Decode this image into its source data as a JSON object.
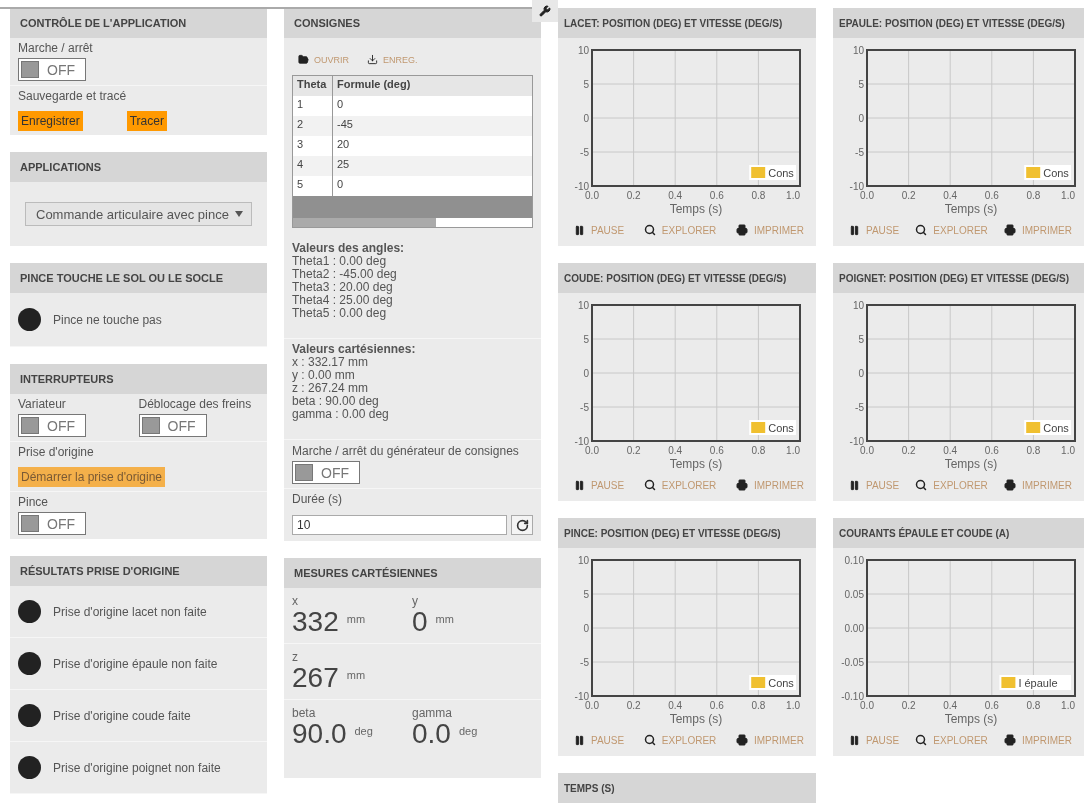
{
  "columns": [
    {
      "panels": [
        {
          "title": "CONTRÔLE DE L'APPLICATION",
          "rows": [
            {
              "kind": "toggle",
              "label": "Marche / arrêt",
              "toggle": {
                "text": "OFF",
                "on": false
              }
            },
            {
              "kind": "buttons",
              "label": "Sauvegarde et tracé",
              "buttons": [
                {
                  "text": "Enregistrer",
                  "disabled": false
                },
                {
                  "text": "Tracer",
                  "disabled": false
                }
              ]
            }
          ]
        },
        {
          "title": "APPLICATIONS",
          "rows": [
            {
              "kind": "select",
              "value": "Commande articulaire avec pince"
            }
          ]
        },
        {
          "title": "PINCE TOUCHE LE SOL OU LE SOCLE",
          "rows": [
            {
              "kind": "indicator",
              "text": "Pince ne touche pas",
              "lit": false
            }
          ]
        },
        {
          "title": "INTERRUPTEURS",
          "rows": [
            {
              "kind": "toggle_pair",
              "toggles": [
                {
                  "label": "Variateur",
                  "text": "OFF",
                  "on": false
                },
                {
                  "label": "Déblocage des freins",
                  "text": "OFF",
                  "on": false
                }
              ]
            },
            {
              "kind": "buttons",
              "label": "Prise d'origine",
              "buttons": [
                {
                  "text": "Démarrer la prise d'origine",
                  "disabled": true
                }
              ]
            },
            {
              "kind": "toggle",
              "label": "Pince",
              "toggle": {
                "text": "OFF",
                "on": false
              }
            }
          ]
        },
        {
          "title": "RÉSULTATS PRISE D'ORIGINE",
          "rows": [
            {
              "kind": "indicator",
              "text": "Prise d'origine lacet non faite",
              "lit": false
            },
            {
              "kind": "indicator",
              "text": "Prise d'origine épaule non faite",
              "lit": false
            },
            {
              "kind": "indicator",
              "text": "Prise d'origine coude faite",
              "lit": false
            },
            {
              "kind": "indicator",
              "text": "Prise d'origine poignet non faite",
              "lit": false
            }
          ]
        }
      ]
    },
    {
      "panels": [
        {
          "title": "CONSIGNES",
          "rows": [
            {
              "kind": "file_actions",
              "actions": [
                {
                  "kind": "open",
                  "label": "OUVRIR"
                },
                {
                  "kind": "save",
                  "label": "ENREG."
                }
              ]
            },
            {
              "kind": "table",
              "columns": [
                "Theta",
                "Formule (deg)"
              ],
              "rows": [
                [
                  "1",
                  "0"
                ],
                [
                  "2",
                  "-45"
                ],
                [
                  "3",
                  "20"
                ],
                [
                  "4",
                  "25"
                ],
                [
                  "5",
                  "0"
                ]
              ]
            },
            {
              "kind": "readout",
              "heading": "Valeurs des angles:",
              "lines": [
                "Theta1 : 0.00 deg",
                "Theta2 : -45.00 deg",
                "Theta3 : 20.00 deg",
                "Theta4 : 25.00 deg",
                "Theta5 : 0.00 deg"
              ]
            },
            {
              "kind": "readout",
              "heading": "Valeurs cartésiennes:",
              "lines": [
                "x : 332.17 mm",
                "y : 0.00 mm",
                "z : 267.24 mm",
                "beta : 90.00 deg",
                "gamma : 0.00 deg"
              ]
            },
            {
              "kind": "toggle",
              "label": "Marche / arrêt du générateur de consignes",
              "toggle": {
                "text": "OFF",
                "on": false
              }
            },
            {
              "kind": "input",
              "label": "Durée (s)",
              "value": "10"
            }
          ]
        },
        {
          "title": "MESURES CARTÉSIENNES",
          "rows": [
            {
              "kind": "measures",
              "items": [
                {
                  "name": "x",
                  "value": "332",
                  "unit": "mm"
                },
                {
                  "name": "y",
                  "value": "0",
                  "unit": "mm"
                }
              ]
            },
            {
              "kind": "measures",
              "items": [
                {
                  "name": "z",
                  "value": "267",
                  "unit": "mm"
                }
              ]
            },
            {
              "kind": "measures",
              "items": [
                {
                  "name": "beta",
                  "value": "90.0",
                  "unit": "deg"
                },
                {
                  "name": "gamma",
                  "value": "0.0",
                  "unit": "deg"
                }
              ]
            }
          ]
        }
      ]
    }
  ],
  "charts": [
    {
      "title": "LACET: POSITION (DEG) ET VITESSE (DEG/S)",
      "chart_data": {
        "type": "line",
        "grid": true,
        "xlabel": "Temps (s)",
        "ylim": [
          -10,
          10
        ],
        "categories": [
          "0.0",
          "0.2",
          "0.4",
          "0.6",
          "0.8",
          "1.0"
        ],
        "yticks": [
          -10,
          -5,
          0,
          5,
          10
        ],
        "series": [
          {
            "name": "Cons",
            "color": "#f0c030",
            "values": [
              null,
              null,
              null,
              null,
              null,
              null
            ]
          }
        ]
      },
      "tools": [
        {
          "kind": "pause",
          "label": "PAUSE"
        },
        {
          "kind": "explore",
          "label": "EXPLORER"
        },
        {
          "kind": "print",
          "label": "IMPRIMER"
        }
      ]
    },
    {
      "title": "EPAULE: POSITION (DEG) ET VITESSE (DEG/S)",
      "chart_data": {
        "type": "line",
        "grid": true,
        "xlabel": "Temps (s)",
        "ylim": [
          -10,
          10
        ],
        "categories": [
          "0.0",
          "0.2",
          "0.4",
          "0.6",
          "0.8",
          "1.0"
        ],
        "yticks": [
          -10,
          -5,
          0,
          5,
          10
        ],
        "series": [
          {
            "name": "Cons",
            "color": "#f0c030",
            "values": [
              null,
              null,
              null,
              null,
              null,
              null
            ]
          }
        ]
      },
      "tools": [
        {
          "kind": "pause",
          "label": "PAUSE"
        },
        {
          "kind": "explore",
          "label": "EXPLORER"
        },
        {
          "kind": "print",
          "label": "IMPRIMER"
        }
      ]
    },
    {
      "title": "COUDE: POSITION (DEG) ET VITESSE (DEG/S)",
      "chart_data": {
        "type": "line",
        "grid": true,
        "xlabel": "Temps (s)",
        "ylim": [
          -10,
          10
        ],
        "categories": [
          "0.0",
          "0.2",
          "0.4",
          "0.6",
          "0.8",
          "1.0"
        ],
        "yticks": [
          -10,
          -5,
          0,
          5,
          10
        ],
        "series": [
          {
            "name": "Cons",
            "color": "#f0c030",
            "values": [
              null,
              null,
              null,
              null,
              null,
              null
            ]
          }
        ]
      },
      "tools": [
        {
          "kind": "pause",
          "label": "PAUSE"
        },
        {
          "kind": "explore",
          "label": "EXPLORER"
        },
        {
          "kind": "print",
          "label": "IMPRIMER"
        }
      ]
    },
    {
      "title": "POIGNET: POSITION (DEG) ET VITESSE (DEG/S)",
      "chart_data": {
        "type": "line",
        "grid": true,
        "xlabel": "Temps (s)",
        "ylim": [
          -10,
          10
        ],
        "categories": [
          "0.0",
          "0.2",
          "0.4",
          "0.6",
          "0.8",
          "1.0"
        ],
        "yticks": [
          -10,
          -5,
          0,
          5,
          10
        ],
        "series": [
          {
            "name": "Cons",
            "color": "#f0c030",
            "values": [
              null,
              null,
              null,
              null,
              null,
              null
            ]
          }
        ]
      },
      "tools": [
        {
          "kind": "pause",
          "label": "PAUSE"
        },
        {
          "kind": "explore",
          "label": "EXPLORER"
        },
        {
          "kind": "print",
          "label": "IMPRIMER"
        }
      ]
    },
    {
      "title": "PINCE: POSITION (DEG) ET VITESSE (DEG/S)",
      "chart_data": {
        "type": "line",
        "grid": true,
        "xlabel": "Temps (s)",
        "ylim": [
          -10,
          10
        ],
        "categories": [
          "0.0",
          "0.2",
          "0.4",
          "0.6",
          "0.8",
          "1.0"
        ],
        "yticks": [
          -10,
          -5,
          0,
          5,
          10
        ],
        "series": [
          {
            "name": "Cons",
            "color": "#f0c030",
            "values": [
              null,
              null,
              null,
              null,
              null,
              null
            ]
          }
        ]
      },
      "tools": [
        {
          "kind": "pause",
          "label": "PAUSE"
        },
        {
          "kind": "explore",
          "label": "EXPLORER"
        },
        {
          "kind": "print",
          "label": "IMPRIMER"
        }
      ]
    },
    {
      "title": "COURANTS ÉPAULE ET COUDE (A)",
      "chart_data": {
        "type": "line",
        "grid": true,
        "xlabel": "Temps (s)",
        "ylim": [
          -0.1,
          0.1
        ],
        "categories": [
          "0.0",
          "0.2",
          "0.4",
          "0.6",
          "0.8",
          "1.0"
        ],
        "yticks": [
          {
            "value": -0.1,
            "label": "-0.10"
          },
          {
            "value": -0.05,
            "label": "-0.05"
          },
          {
            "value": 0,
            "label": "0.00"
          },
          {
            "value": 0.05,
            "label": "0.05"
          },
          {
            "value": 0.1,
            "label": "0.10"
          }
        ],
        "series": [
          {
            "name": "I épaule",
            "color": "#f0c030",
            "values": [
              null,
              null,
              null,
              null,
              null,
              null
            ]
          }
        ]
      },
      "tools": [
        {
          "kind": "pause",
          "label": "PAUSE"
        },
        {
          "kind": "explore",
          "label": "EXPLORER"
        },
        {
          "kind": "print",
          "label": "IMPRIMER"
        }
      ]
    },
    {
      "title": "TEMPS (S)"
    }
  ]
}
